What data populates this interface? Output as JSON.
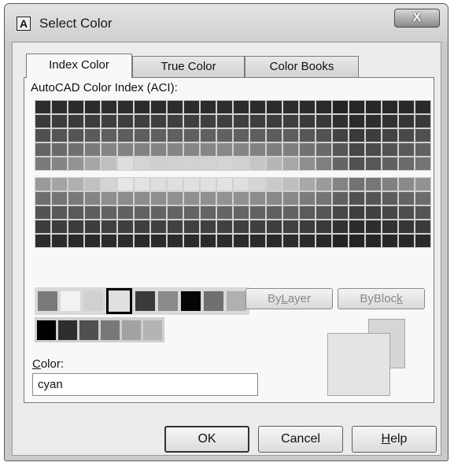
{
  "window": {
    "title": "Select Color",
    "icon": "autocad-a-icon",
    "icon_letter": "A"
  },
  "tabs": [
    {
      "label": "Index Color",
      "active": true
    },
    {
      "label": "True Color",
      "active": false
    },
    {
      "label": "Color Books",
      "active": false
    }
  ],
  "aci_label": "AutoCAD Color Index (ACI):",
  "grid_top_colors": [
    [
      "#2d2d2d",
      "#2d2d2d",
      "#2b2b2b",
      "#2b2b2b",
      "#2d2d2d",
      "#2d2d2d",
      "#2b2b2b",
      "#2c2c2c",
      "#2d2d2d",
      "#2c2c2c",
      "#2c2c2c",
      "#2d2d2d",
      "#2c2c2c",
      "#2b2b2b",
      "#2b2b2b",
      "#2d2d2d",
      "#2c2c2c",
      "#2a2a2a",
      "#252525",
      "#262626",
      "#272727",
      "#282828",
      "#292929",
      "#2b2b2b"
    ],
    [
      "#3b3b3b",
      "#3c3c3c",
      "#3b3b3b",
      "#3c3c3c",
      "#3f3f3f",
      "#3e3e3e",
      "#3e3e3e",
      "#3f3f3f",
      "#404040",
      "#3f3f3f",
      "#3f3f3f",
      "#404040",
      "#3f3f3f",
      "#3e3e3e",
      "#3d3d3d",
      "#3f3f3f",
      "#3b3b3b",
      "#393939",
      "#303030",
      "#2b2b2b",
      "#2d2d2d",
      "#313131",
      "#353535",
      "#3a3a3a"
    ],
    [
      "#505050",
      "#545454",
      "#555555",
      "#5a5a5a",
      "#5f5f5f",
      "#5d5d5d",
      "#5e5e5e",
      "#5f5f5f",
      "#606060",
      "#606060",
      "#606060",
      "#616161",
      "#606060",
      "#5e5e5e",
      "#5c5c5c",
      "#5e5e5e",
      "#575757",
      "#525252",
      "#434343",
      "#3a3a3a",
      "#3d3d3d",
      "#434343",
      "#494949",
      "#505050"
    ],
    [
      "#646464",
      "#6a6a6a",
      "#707070",
      "#7a7a7a",
      "#848484",
      "#828282",
      "#828282",
      "#848484",
      "#868686",
      "#868686",
      "#868686",
      "#888888",
      "#868686",
      "#828282",
      "#7e7e7e",
      "#7e7e7e",
      "#727272",
      "#6a6a6a",
      "#565656",
      "#474747",
      "#4b4b4b",
      "#535353",
      "#5a5a5a",
      "#626262"
    ],
    [
      "#7a7a7a",
      "#858585",
      "#939393",
      "#a6a6a6",
      "#bfbfbf",
      "#dedede",
      "#d4d4d4",
      "#cfcfcf",
      "#d1d1d1",
      "#d2d2d2",
      "#d2d2d2",
      "#d4d4d4",
      "#d1d1d1",
      "#c6c6c6",
      "#b6b6b6",
      "#a8a8a8",
      "#8f8f8f",
      "#7f7f7f",
      "#656565",
      "#525252",
      "#575757",
      "#616161",
      "#6a6a6a",
      "#747474"
    ]
  ],
  "grid_bottom_colors": [
    [
      "#9a9a9a",
      "#a4a4a4",
      "#b0b0b0",
      "#c0c0c0",
      "#d4d4d4",
      "#e6e6e6",
      "#e2e2e2",
      "#dedede",
      "#dfdfdf",
      "#e0e0e0",
      "#e0e0e0",
      "#e2e2e2",
      "#dfdfdf",
      "#d6d6d6",
      "#cacaca",
      "#bebebe",
      "#a8a8a8",
      "#9b9b9b",
      "#848484",
      "#727272",
      "#777777",
      "#818181",
      "#8a8a8a",
      "#939393"
    ],
    [
      "#6e6e6e",
      "#747474",
      "#7a7a7a",
      "#848484",
      "#8e8e8e",
      "#8c8c8c",
      "#8c8c8c",
      "#8e8e8e",
      "#909090",
      "#909090",
      "#909090",
      "#929292",
      "#909090",
      "#8c8c8c",
      "#888888",
      "#888888",
      "#7c7c7c",
      "#747474",
      "#606060",
      "#515151",
      "#555555",
      "#5d5d5d",
      "#646464",
      "#6c6c6c"
    ],
    [
      "#545454",
      "#585858",
      "#595959",
      "#5e5e5e",
      "#636363",
      "#616161",
      "#626262",
      "#636363",
      "#646464",
      "#646464",
      "#646464",
      "#656565",
      "#646464",
      "#626262",
      "#606060",
      "#626262",
      "#5b5b5b",
      "#565656",
      "#474747",
      "#3e3e3e",
      "#414141",
      "#474747",
      "#4d4d4d",
      "#545454"
    ],
    [
      "#3c3c3c",
      "#3d3d3d",
      "#3c3c3c",
      "#3d3d3d",
      "#404040",
      "#3f3f3f",
      "#3f3f3f",
      "#404040",
      "#414141",
      "#404040",
      "#404040",
      "#414141",
      "#404040",
      "#3f3f3f",
      "#3e3e3e",
      "#404040",
      "#3c3c3c",
      "#3a3a3a",
      "#313131",
      "#2c2c2c",
      "#2e2e2e",
      "#323232",
      "#363636",
      "#3b3b3b"
    ],
    [
      "#2c2c2c",
      "#2c2c2c",
      "#2a2a2a",
      "#2a2a2a",
      "#2c2c2c",
      "#2c2c2c",
      "#2a2a2a",
      "#2b2b2b",
      "#2c2c2c",
      "#2b2b2b",
      "#2b2b2b",
      "#2c2c2c",
      "#2b2b2b",
      "#2a2a2a",
      "#2a2a2a",
      "#2c2c2c",
      "#2b2b2b",
      "#292929",
      "#242424",
      "#252525",
      "#262626",
      "#272727",
      "#282828",
      "#2a2a2a"
    ]
  ],
  "standard_colors": [
    "#7a7a7a",
    "#f2f2f2",
    "#d0d0d0",
    "#e0e0e0",
    "#3a3a3a",
    "#8a8a8a",
    "#050505",
    "#707070",
    "#b0b0b0"
  ],
  "selected_standard_index": 3,
  "gray_shades": [
    "#000000",
    "#2e2e2e",
    "#505050",
    "#787878",
    "#a2a2a2",
    "#b4b4b4"
  ],
  "by_buttons": {
    "bylayer_pre": "By",
    "bylayer_u": "L",
    "bylayer_post": "ayer",
    "byblock_pre": "ByBloc",
    "byblock_u": "k",
    "byblock_post": ""
  },
  "color_field": {
    "label_u": "C",
    "label_rest": "olor:",
    "value": "cyan"
  },
  "preview": {
    "old_color": "#d6d6d6",
    "new_color": "#e4e4e4"
  },
  "buttons": {
    "ok": "OK",
    "cancel": "Cancel",
    "help_u": "H",
    "help_rest": "elp"
  },
  "close_glyph": "X"
}
